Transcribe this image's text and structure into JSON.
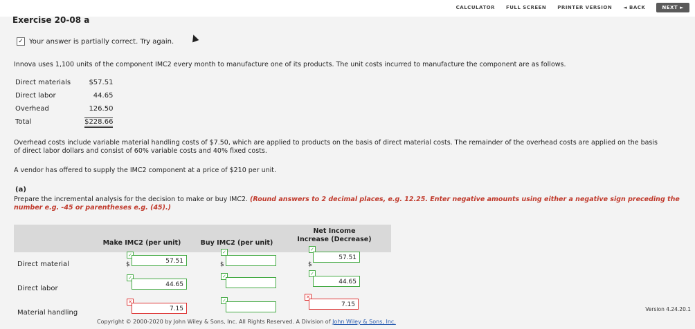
{
  "toolbar": {
    "calculator": "CALCULATOR",
    "full_screen": "FULL SCREEN",
    "printer_version": "PRINTER VERSION",
    "back": "◄ BACK",
    "next": "NEXT ►"
  },
  "exercise_title": "Exercise 20-08 a",
  "partial_msg": "Your answer is partially correct.  Try again.",
  "intro": "Innova uses 1,100 units of the component IMC2 every month to manufacture one of its products. The unit costs incurred to manufacture the component are as follows.",
  "costs": [
    {
      "label": "Direct materials",
      "amount": "$57.51"
    },
    {
      "label": "Direct labor",
      "amount": "44.65"
    },
    {
      "label": "Overhead",
      "amount": "126.50"
    },
    {
      "label": "Total",
      "amount": "$228.66"
    }
  ],
  "overhead_note_1": "Overhead costs include variable material handling costs of $7.50, which are applied to products on the basis of direct material costs. The remainder of the overhead costs are applied on the basis",
  "overhead_note_2": "of direct labor dollars and consist of 60% variable costs and 40% fixed costs.",
  "vendor_note": "A vendor has offered to supply the IMC2 component at a price of $210 per unit.",
  "part_label": "(a)",
  "prepare_plain": "Prepare the incremental analysis for the decision to make or buy IMC2. ",
  "prepare_emph": "(Round answers to 2 decimal places, e.g. 12.25. Enter negative amounts using either a negative sign preceding the number e.g. -45 or parentheses e.g. (45).)",
  "table": {
    "col_make": "Make IMC2 (per unit)",
    "col_buy": "Buy IMC2 (per unit)",
    "col_net_1": "Net Income",
    "col_net_2": "Increase (Decrease)",
    "rows": [
      {
        "label": "Direct material",
        "make": "57.51",
        "buy": "",
        "net": "57.51"
      },
      {
        "label": "Direct labor",
        "make": "44.65",
        "buy": "",
        "net": "44.65"
      },
      {
        "label": "Material handling",
        "make": "7.15",
        "buy": "",
        "net": "7.15"
      }
    ],
    "dollar": "$"
  },
  "version": "Version 4.24.20.1",
  "footer_prefix": "Copyright © 2000-2020 by John Wiley & Sons, Inc. All Rights Reserved. A Division of ",
  "footer_link": "John Wiley & Sons, Inc."
}
